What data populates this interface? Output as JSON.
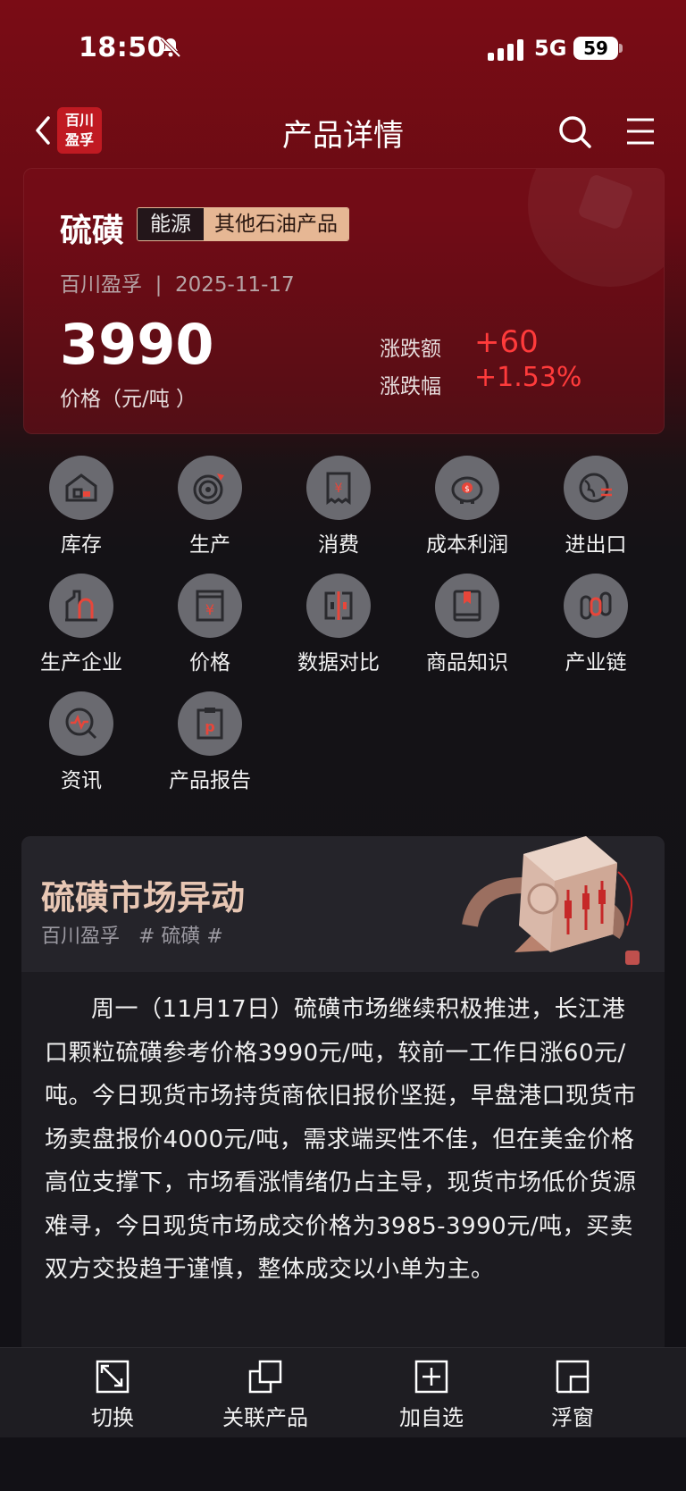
{
  "status": {
    "time": "18:50",
    "network": "5G",
    "battery": "59"
  },
  "nav": {
    "logo_line1": "百川",
    "logo_line2": "盈孚",
    "title": "产品详情"
  },
  "product": {
    "name": "硫磺",
    "tag_category": "能源",
    "tag_subcategory": "其他石油产品",
    "source": "百川盈孚",
    "separator": "|",
    "date": "2025-11-17",
    "price": "3990",
    "price_unit": "价格（元/吨 ）",
    "change_label": "涨跌额",
    "change_value": "+60",
    "change_pct_label": "涨跌幅",
    "change_pct_value": "+1.53%",
    "accent_up_color": "#ff3b3b"
  },
  "functions": [
    {
      "label": "库存",
      "icon": "warehouse-icon"
    },
    {
      "label": "生产",
      "icon": "target-icon"
    },
    {
      "label": "消费",
      "icon": "receipt-icon"
    },
    {
      "label": "成本利润",
      "icon": "piggy-bank-icon"
    },
    {
      "label": "进出口",
      "icon": "globe-exchange-icon"
    },
    {
      "label": "生产企业",
      "icon": "factory-icon"
    },
    {
      "label": "价格",
      "icon": "price-tag-icon"
    },
    {
      "label": "数据对比",
      "icon": "compare-icon"
    },
    {
      "label": "商品知识",
      "icon": "book-icon"
    },
    {
      "label": "产业链",
      "icon": "chain-icon"
    },
    {
      "label": "资讯",
      "icon": "news-search-icon"
    },
    {
      "label": "产品报告",
      "icon": "report-icon"
    }
  ],
  "news": {
    "title": "硫磺市场异动",
    "source": "百川盈孚",
    "hashtag": "# 硫磺 #",
    "body": "周一（11月17日）硫磺市场继续积极推进，长江港口颗粒硫磺参考价格3990元/吨，较前一工作日涨60元/吨。今日现货市场持货商依旧报价坚挺，早盘港口现货市场卖盘报价4000元/吨，需求端买性不佳，但在美金价格高位支撑下，市场看涨情绪仍占主导，现货市场低价货源难寻，今日现货市场成交价格为3985-3990元/吨，买卖双方交投趋于谨慎，整体成交以小单为主。"
  },
  "bottom_bar": [
    {
      "label": "切换",
      "icon": "switch-icon"
    },
    {
      "label": "关联产品",
      "icon": "related-icon"
    },
    {
      "label": "加自选",
      "icon": "add-watchlist-icon"
    },
    {
      "label": "浮窗",
      "icon": "float-window-icon"
    }
  ]
}
